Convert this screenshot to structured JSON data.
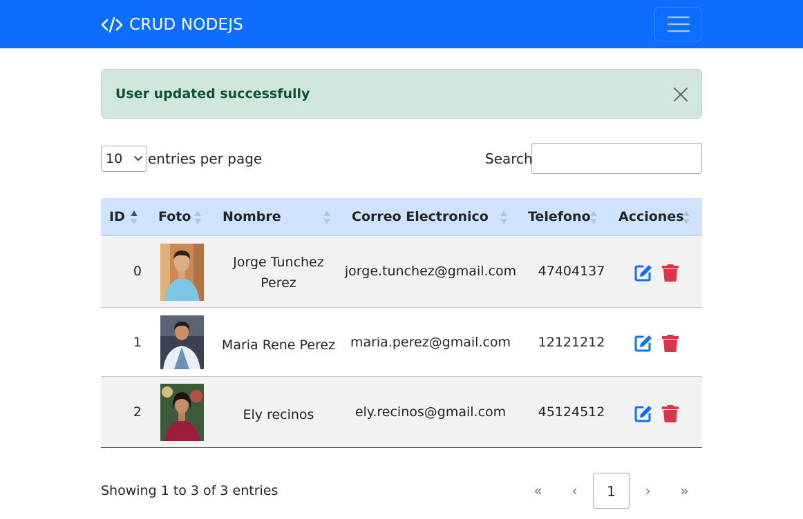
{
  "navbar": {
    "brand": "CRUD NODEJS",
    "brand_icon": "code-icon",
    "toggler_icon": "hamburger-menu-icon",
    "bg_color": "#0d6efd"
  },
  "alert": {
    "message": "User updated successfully",
    "close_icon": "close-icon",
    "bg_color": "#d1e7dd"
  },
  "datatable": {
    "entries_per_page": "10",
    "entries_per_page_label": "entries per page",
    "search_label": "Search:",
    "search_value": "",
    "columns": [
      "ID",
      "Foto",
      "Nombre",
      "Correo Electronico",
      "Telefono",
      "Acciones"
    ],
    "sorted_column": "ID",
    "header_bg": "#cfe2ff",
    "rows": [
      {
        "id": "0",
        "nombre": "Jorge Tunchez Perez",
        "correo": "jorge.tunchez@gmail.com",
        "telefono": "47404137"
      },
      {
        "id": "1",
        "nombre": "Maria Rene Perez",
        "correo": "maria.perez@gmail.com",
        "telefono": "12121212"
      },
      {
        "id": "2",
        "nombre": "Ely recinos",
        "correo": "ely.recinos@gmail.com",
        "telefono": "45124512"
      }
    ],
    "actions": {
      "edit_icon": "edit-icon",
      "delete_icon": "trash-icon",
      "edit_color": "#0d6efd",
      "delete_color": "#dc3545"
    },
    "info": "Showing 1 to 3 of 3 entries",
    "pagination": {
      "first": "«",
      "prev": "‹",
      "current": "1",
      "next": "›",
      "last": "»"
    }
  }
}
